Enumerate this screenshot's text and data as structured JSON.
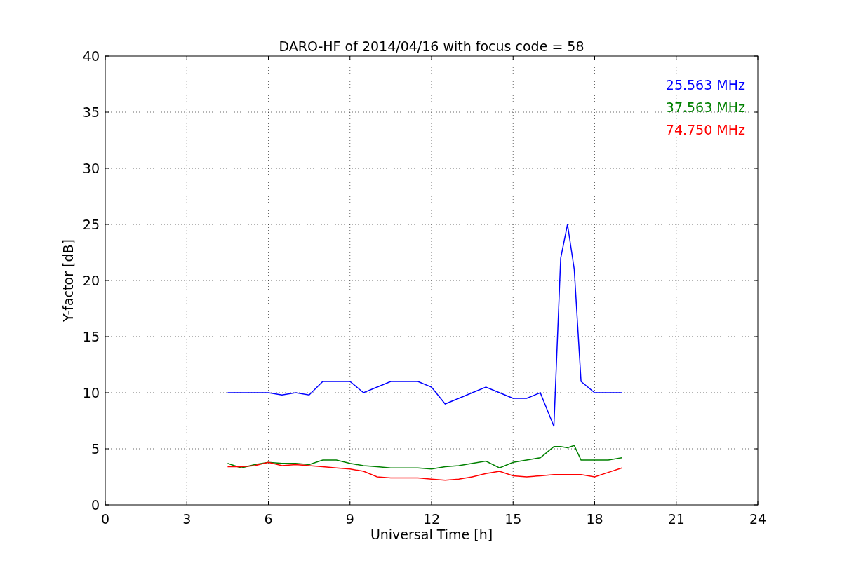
{
  "chart_data": {
    "type": "line",
    "title": "DARO-HF of 2014/04/16 with focus code = 58",
    "xlabel": "Universal Time [h]",
    "ylabel": "Y-factor [dB]",
    "x": [
      4.5,
      5,
      5.5,
      6,
      6.5,
      7,
      7.5,
      8,
      8.5,
      9,
      9.5,
      10,
      10.5,
      11,
      11.5,
      12,
      12.5,
      13,
      13.5,
      14,
      14.5,
      15,
      15.5,
      16,
      16.5,
      16.75,
      17,
      17.25,
      17.5,
      18,
      18.5,
      19
    ],
    "series": [
      {
        "name": "25.563 MHz",
        "color": "#0000ff",
        "values": [
          10,
          10,
          10,
          10,
          9.8,
          10,
          9.8,
          11,
          11,
          11,
          10,
          10.5,
          11,
          11,
          11,
          10.5,
          9,
          9.5,
          10,
          10.5,
          10,
          9.5,
          9.5,
          10,
          7,
          22,
          25,
          21,
          11,
          10,
          10,
          10
        ]
      },
      {
        "name": "37.563 MHz",
        "color": "#008000",
        "values": [
          3.7,
          3.3,
          3.6,
          3.8,
          3.7,
          3.7,
          3.6,
          4,
          4,
          3.7,
          3.5,
          3.4,
          3.3,
          3.3,
          3.3,
          3.2,
          3.4,
          3.5,
          3.7,
          3.9,
          3.3,
          3.8,
          4,
          4.2,
          5.2,
          5.2,
          5.1,
          5.3,
          4,
          4,
          4,
          4.2
        ]
      },
      {
        "name": "74.750 MHz",
        "color": "#ff0000",
        "values": [
          3.4,
          3.4,
          3.5,
          3.8,
          3.5,
          3.6,
          3.5,
          3.4,
          3.3,
          3.2,
          3,
          2.5,
          2.4,
          2.4,
          2.4,
          2.3,
          2.2,
          2.3,
          2.5,
          2.8,
          3,
          2.6,
          2.5,
          2.6,
          2.7,
          2.7,
          2.7,
          2.7,
          2.7,
          2.5,
          2.9,
          3.3
        ]
      }
    ],
    "grid": true,
    "xlim": [
      0,
      24
    ],
    "ylim": [
      0,
      40
    ],
    "xticks": [
      0,
      3,
      6,
      9,
      12,
      15,
      18,
      21,
      24
    ],
    "yticks": [
      0,
      5,
      10,
      15,
      20,
      25,
      30,
      35,
      40
    ]
  }
}
